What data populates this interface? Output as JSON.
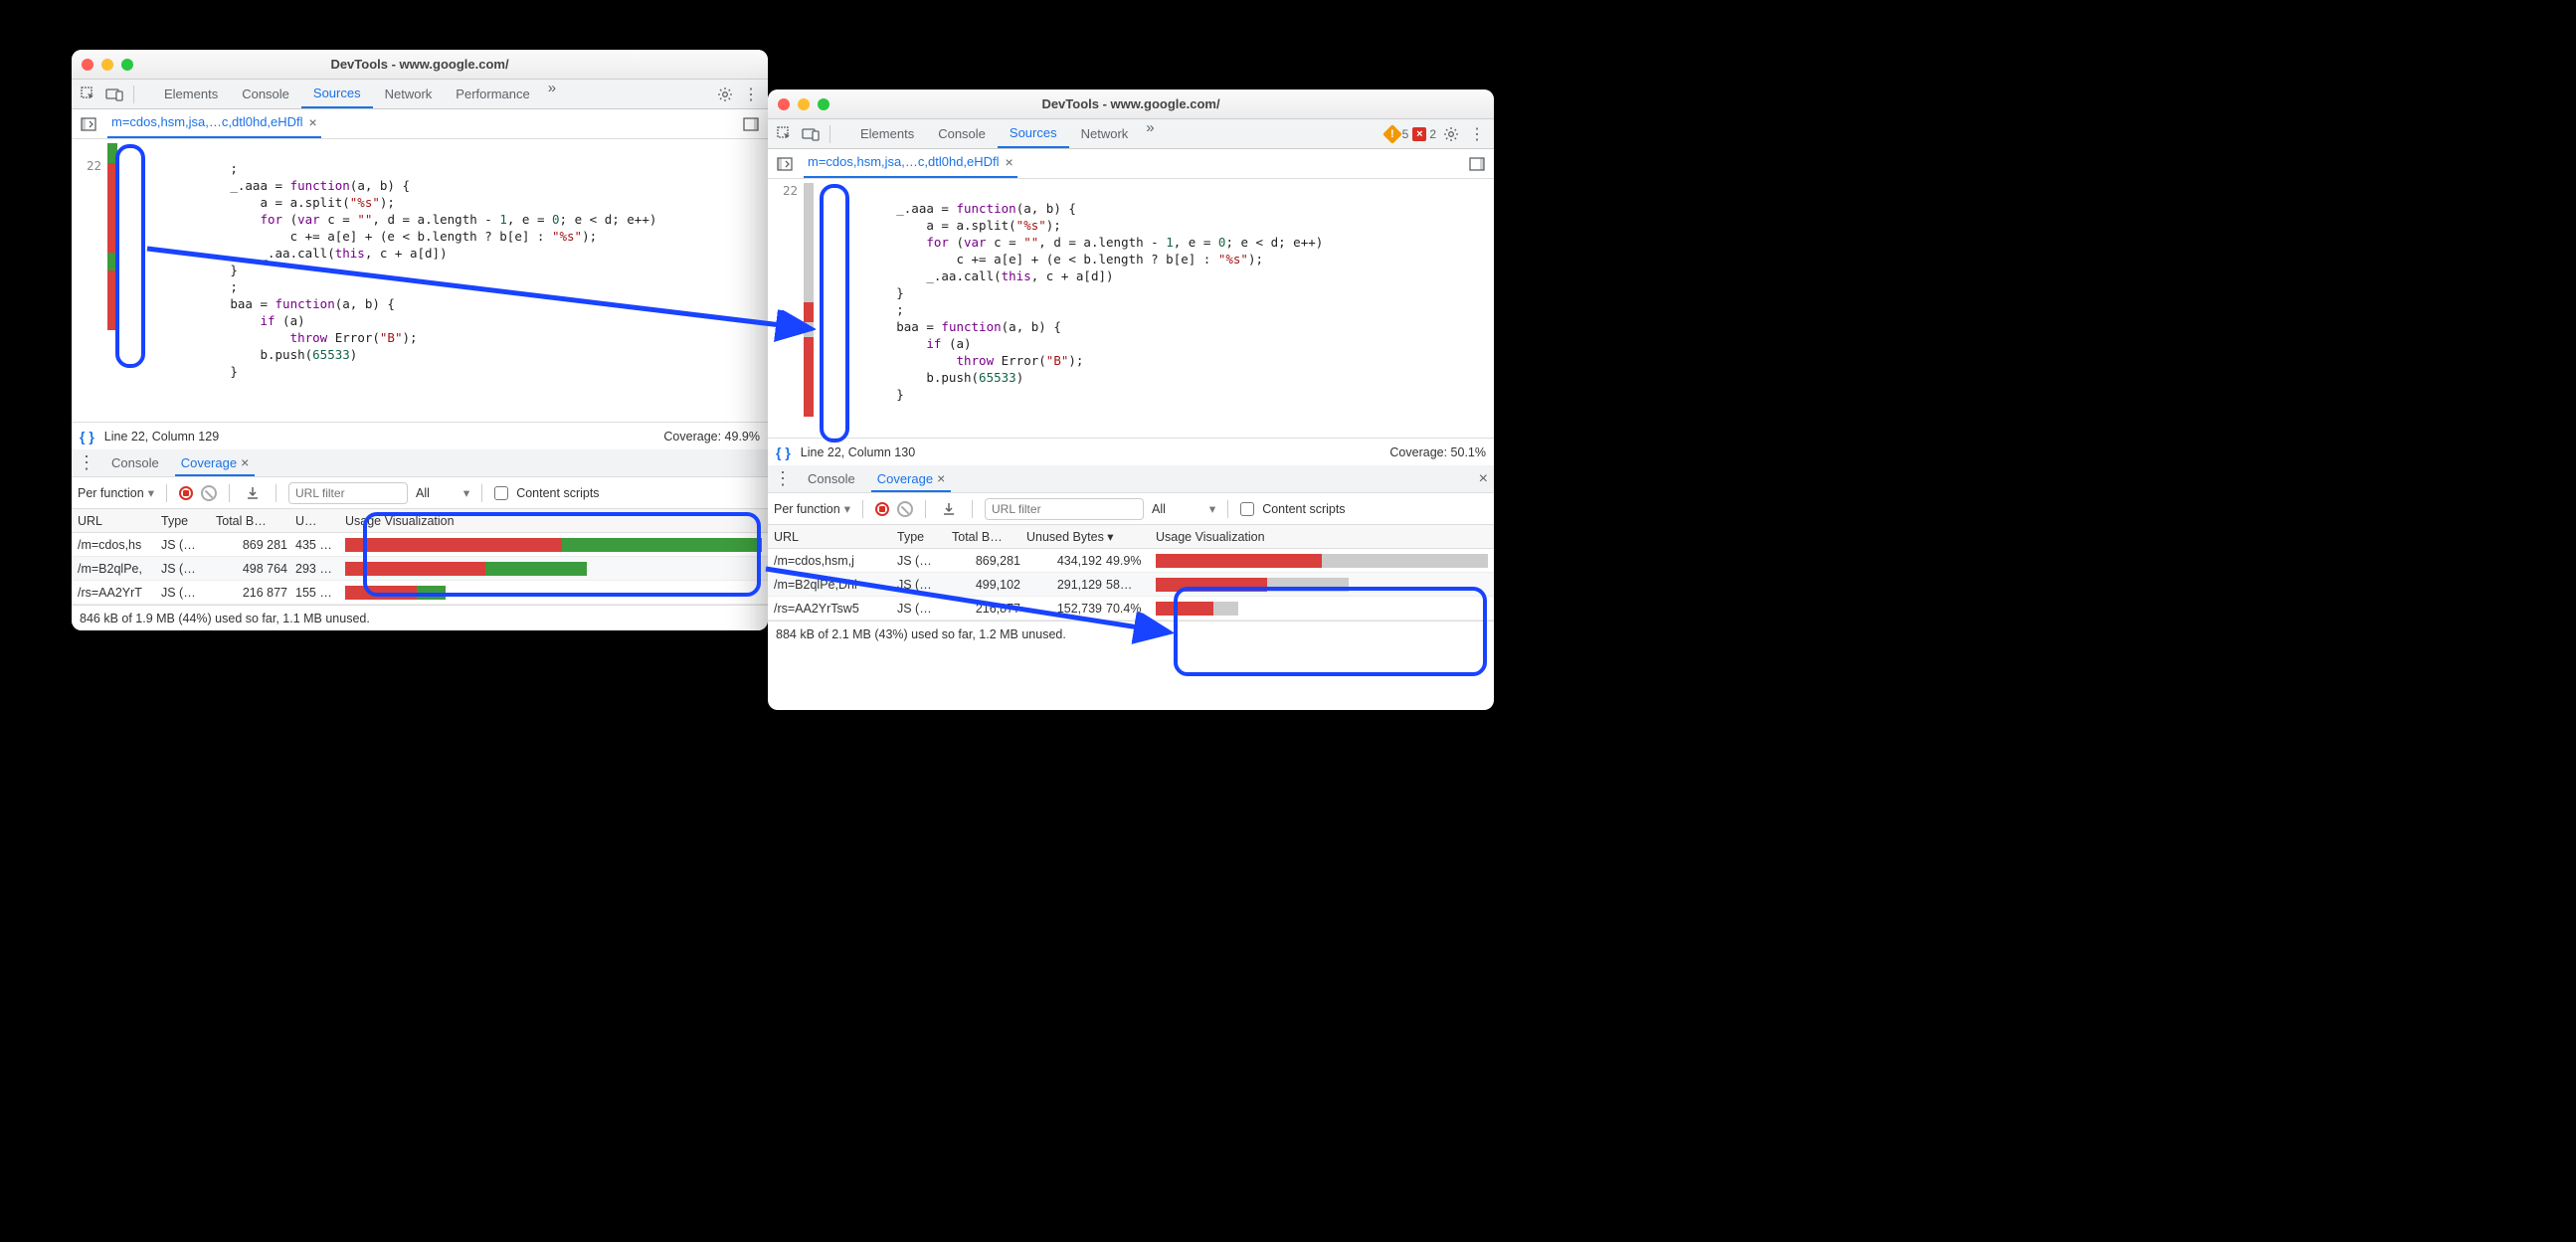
{
  "colors": {
    "red": "#d93f3c",
    "green": "#3c9b3c",
    "grey": "#ccc",
    "accent": "#1843ff",
    "link": "#1a73e8"
  },
  "left": {
    "title": "DevTools - www.google.com/",
    "panels": [
      "Elements",
      "Console",
      "Sources",
      "Network",
      "Performance"
    ],
    "active_panel": "Sources",
    "more": "»",
    "file_tab": "m=cdos,hsm,jsa,…c,dtl0hd,eHDfl",
    "line_no": "22",
    "status": "Line 22, Column 129",
    "coverage_status": "Coverage: 49.9%",
    "drawer": {
      "tabs": [
        "Console",
        "Coverage"
      ],
      "active": "Coverage",
      "filter_mode": "Per function",
      "url_placeholder": "URL filter",
      "type_filter": "All",
      "content_scripts": "Content scripts",
      "columns": [
        "URL",
        "Type",
        "Total B…",
        "U…",
        "Usage Visualization"
      ],
      "rows": [
        {
          "url": "/m=cdos,hs",
          "type": "JS (…",
          "total": "869 281",
          "unused": "435 …",
          "red_pct": 52,
          "green_pct": 48,
          "grey_pct": 0,
          "width_pct": 100
        },
        {
          "url": "/m=B2qlPe,",
          "type": "JS (…",
          "total": "498 764",
          "unused": "293 …",
          "red_pct": 58,
          "green_pct": 42,
          "grey_pct": 0,
          "width_pct": 58
        },
        {
          "url": "/rs=AA2YrT",
          "type": "JS (…",
          "total": "216 877",
          "unused": "155 …",
          "red_pct": 72,
          "green_pct": 28,
          "grey_pct": 0,
          "width_pct": 24
        }
      ],
      "summary": "846 kB of 1.9 MB (44%) used so far, 1.1 MB unused."
    },
    "cov_gutter": [
      {
        "c": "green",
        "h": 20
      },
      {
        "c": "red",
        "h": 45
      },
      {
        "c": "red",
        "h": 45
      },
      {
        "c": "green",
        "h": 18
      },
      {
        "c": "red",
        "h": 60
      }
    ]
  },
  "right": {
    "title": "DevTools - www.google.com/",
    "panels": [
      "Elements",
      "Console",
      "Sources",
      "Network"
    ],
    "active_panel": "Sources",
    "more": "»",
    "warn_count": "5",
    "err_count": "2",
    "file_tab": "m=cdos,hsm,jsa,…c,dtl0hd,eHDfl",
    "line_no": "22",
    "status": "Line 22, Column 130",
    "coverage_status": "Coverage: 50.1%",
    "drawer": {
      "tabs": [
        "Console",
        "Coverage"
      ],
      "active": "Coverage",
      "filter_mode": "Per function",
      "url_placeholder": "URL filter",
      "type_filter": "All",
      "content_scripts": "Content scripts",
      "columns": [
        "URL",
        "Type",
        "Total B…",
        "Unused Bytes ▾",
        "Usage Visualization"
      ],
      "rows": [
        {
          "url": "/m=cdos,hsm,j",
          "type": "JS (…",
          "total": "869,281",
          "unused": "434,192",
          "pct": "49.9%",
          "red_pct": 50,
          "grey_pct": 50,
          "width_pct": 100
        },
        {
          "url": "/m=B2qlPe,Dhl",
          "type": "JS (…",
          "total": "499,102",
          "unused": "291,129",
          "pct": "58…",
          "red_pct": 58,
          "grey_pct": 42,
          "width_pct": 58
        },
        {
          "url": "/rs=AA2YrTsw5",
          "type": "JS (…",
          "total": "216,877",
          "unused": "152,739",
          "pct": "70.4%",
          "red_pct": 70,
          "grey_pct": 30,
          "width_pct": 25
        }
      ],
      "summary": "884 kB of 2.1 MB (43%) used so far, 1.2 MB unused."
    },
    "cov_gutter": [
      {
        "c": "grey",
        "h": 120
      },
      {
        "c": "red",
        "h": 20
      },
      {
        "c": "grey",
        "h": 15
      },
      {
        "c": "red",
        "h": 80
      }
    ]
  },
  "code_lines": [
    "            ;",
    "            _.aaa = function(a, b) {",
    "                a = a.split(\"%s\");",
    "                for (var c = \"\", d = a.length - 1, e = 0; e < d; e++)",
    "                    c += a[e] + (e < b.length ? b[e] : \"%s\");",
    "                _.aa.call(this, c + a[d])",
    "            }",
    "            ;",
    "            baa = function(a, b) {",
    "                if (a)",
    "                    throw Error(\"B\");",
    "                b.push(65533)",
    "            }"
  ]
}
